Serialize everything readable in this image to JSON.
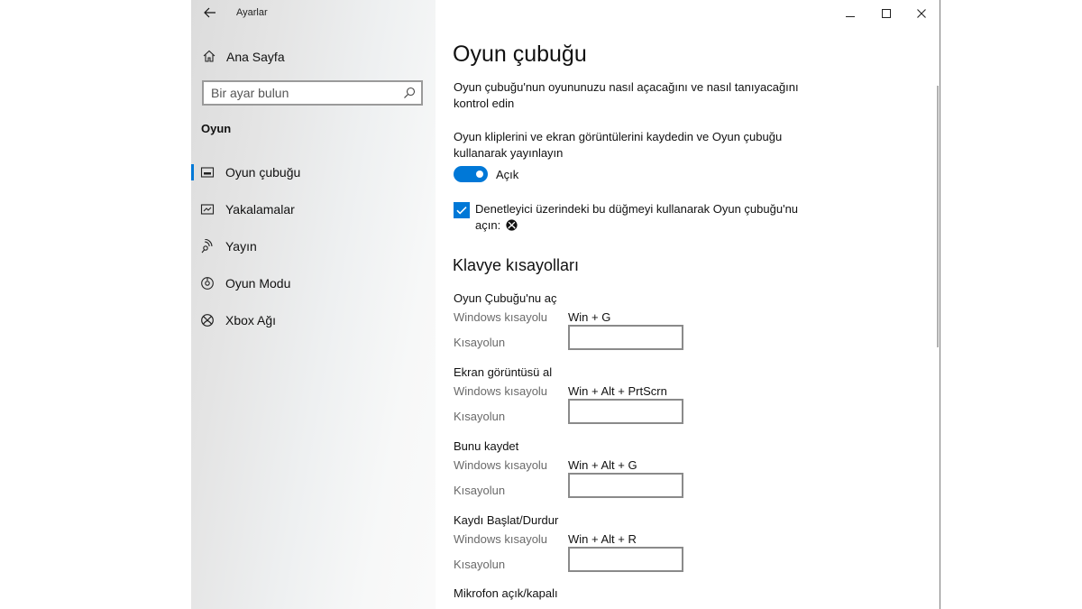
{
  "window": {
    "title": "Ayarlar"
  },
  "sidebar": {
    "home_label": "Ana Sayfa",
    "search": {
      "placeholder": "Bir ayar bulun",
      "value": ""
    },
    "section_title": "Oyun",
    "items": [
      {
        "label": "Oyun çubuğu",
        "icon": "game-bar-icon",
        "selected": true
      },
      {
        "label": "Yakalamalar",
        "icon": "captures-icon",
        "selected": false
      },
      {
        "label": "Yayın",
        "icon": "broadcast-icon",
        "selected": false
      },
      {
        "label": "Oyun Modu",
        "icon": "game-mode-icon",
        "selected": false
      },
      {
        "label": "Xbox Ağı",
        "icon": "xbox-icon",
        "selected": false
      }
    ]
  },
  "content": {
    "title": "Oyun çubuğu",
    "description": "Oyun çubuğu'nun oyununuzu nasıl açacağını ve nasıl tanıyacağını kontrol edin",
    "record_description": "Oyun kliplerini ve ekran görüntülerini kaydedin ve Oyun çubuğu kullanarak yayınlayın",
    "toggle": {
      "state_label": "Açık",
      "on": true
    },
    "controller_checkbox": {
      "label": "Denetleyici üzerindeki bu düğmeyi kullanarak Oyun çubuğu'nu açın:",
      "checked": true
    },
    "shortcuts_heading": "Klavye kısayolları",
    "shortcuts": [
      {
        "title": "Oyun Çubuğu'nu aç",
        "windows_label": "Windows kısayolu",
        "windows_value": "Win + G",
        "custom_label": "Kısayolun",
        "custom_value": ""
      },
      {
        "title": "Ekran görüntüsü al",
        "windows_label": "Windows kısayolu",
        "windows_value": "Win + Alt + PrtScrn",
        "custom_label": "Kısayolun",
        "custom_value": ""
      },
      {
        "title": "Bunu kaydet",
        "windows_label": "Windows kısayolu",
        "windows_value": "Win + Alt + G",
        "custom_label": "Kısayolun",
        "custom_value": ""
      },
      {
        "title": "Kaydı Başlat/Durdur",
        "windows_label": "Windows kısayolu",
        "windows_value": "Win + Alt + R",
        "custom_label": "Kısayolun",
        "custom_value": ""
      },
      {
        "title": "Mikrofon açık/kapalı"
      }
    ]
  },
  "colors": {
    "accent": "#0078d7"
  }
}
